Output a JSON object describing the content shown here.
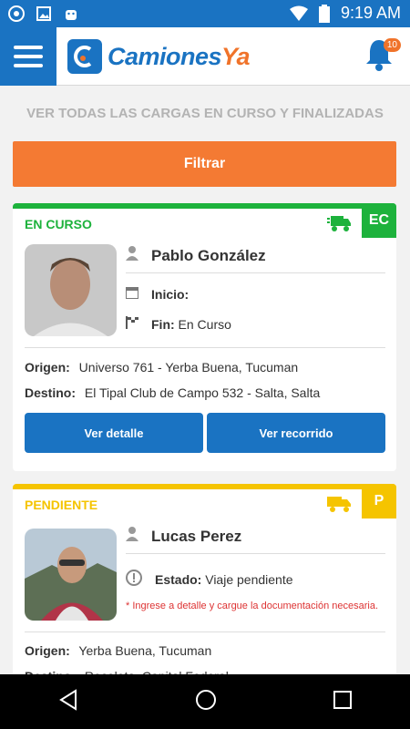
{
  "status_bar": {
    "time": "9:19 AM",
    "icons": [
      "whatsapp-icon",
      "image-icon",
      "android-icon",
      "wifi-icon",
      "battery-icon"
    ]
  },
  "app": {
    "logo_camiones": "Camiones",
    "logo_ya": "Ya",
    "notification_count": "10"
  },
  "subtitle": "VER TODAS LAS CARGAS EN CURSO Y FINALIZADAS",
  "filter_label": "Filtrar",
  "cards": [
    {
      "status": "EN CURSO",
      "code": "EC",
      "color": "#1db23c",
      "name": "Pablo González",
      "inicio_label": "Inicio:",
      "fin_label": "Fin:",
      "fin_value": "En Curso",
      "origen_label": "Origen:",
      "origen_value": "Universo 761 - Yerba Buena, Tucuman",
      "destino_label": "Destino:",
      "destino_value": "El Tipal Club de Campo 532 - Salta, Salta",
      "btn_detail": "Ver detalle",
      "btn_route": "Ver recorrido"
    },
    {
      "status": "PENDIENTE",
      "code": "P",
      "color": "#f5c400",
      "name": "Lucas Perez",
      "estado_label": "Estado:",
      "estado_value": "Viaje pendiente",
      "warning": "* Ingrese a detalle y cargue la documentación necesaria.",
      "origen_label": "Origen:",
      "origen_value": "Yerba Buena, Tucuman",
      "destino_label": "Destino:",
      "destino_value": "Recoleta, Capital Federal"
    }
  ]
}
